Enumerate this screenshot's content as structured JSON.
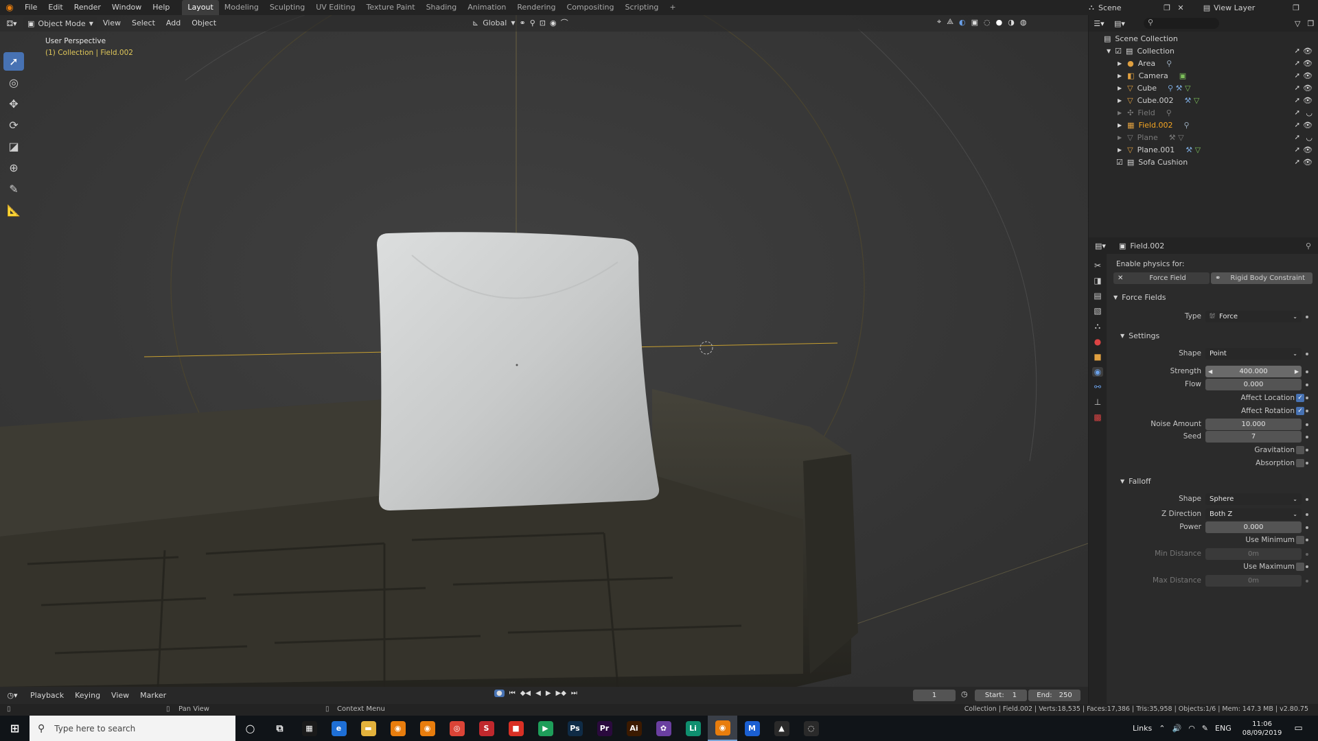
{
  "topbar": {
    "menus": [
      "File",
      "Edit",
      "Render",
      "Window",
      "Help"
    ],
    "workspaces": [
      "Layout",
      "Modeling",
      "Sculpting",
      "UV Editing",
      "Texture Paint",
      "Shading",
      "Animation",
      "Rendering",
      "Compositing",
      "Scripting"
    ],
    "active_workspace": "Layout",
    "add_tab_label": "+",
    "scene_label": "Scene",
    "view_layer_label": "View Layer"
  },
  "viewport_header": {
    "mode": "Object Mode",
    "menus": [
      "View",
      "Select",
      "Add",
      "Object"
    ],
    "transform_orientation": "Global"
  },
  "viewport": {
    "perspective_label": "User Perspective",
    "collection_label": "(1) Collection | Field.002",
    "colors": {
      "cushion": "#cfd1d1",
      "sofa": "#3a382f",
      "background": "#393939",
      "field_lines": "#c8a030"
    }
  },
  "outliner": {
    "root": "Scene Collection",
    "items": [
      {
        "name": "Collection",
        "state": "normal"
      },
      {
        "name": "Area",
        "state": "normal"
      },
      {
        "name": "Camera",
        "state": "normal"
      },
      {
        "name": "Cube",
        "state": "normal"
      },
      {
        "name": "Cube.002",
        "state": "normal"
      },
      {
        "name": "Field",
        "state": "dim"
      },
      {
        "name": "Field.002",
        "state": "selected"
      },
      {
        "name": "Plane",
        "state": "dim"
      },
      {
        "name": "Plane.001",
        "state": "normal"
      },
      {
        "name": "Sofa Cushion",
        "state": "normal"
      }
    ]
  },
  "properties": {
    "object_name": "Field.002",
    "enable_physics_label": "Enable physics for:",
    "force_field_button": "Force Field",
    "rigid_body_button": "Rigid Body Constraint",
    "force_fields_panel": "Force Fields",
    "type_label": "Type",
    "type_value": "Force",
    "settings_panel": "Settings",
    "shape_label": "Shape",
    "shape_value": "Point",
    "strength_label": "Strength",
    "strength_value": "400.000",
    "flow_label": "Flow",
    "flow_value": "0.000",
    "affect_location_label": "Affect Location",
    "affect_location": true,
    "affect_rotation_label": "Affect Rotation",
    "affect_rotation": true,
    "noise_amount_label": "Noise Amount",
    "noise_amount_value": "10.000",
    "seed_label": "Seed",
    "seed_value": "7",
    "gravitation_label": "Gravitation",
    "absorption_label": "Absorption",
    "falloff_panel": "Falloff",
    "falloff_shape_label": "Shape",
    "falloff_shape_value": "Sphere",
    "z_direction_label": "Z Direction",
    "z_direction_value": "Both Z",
    "power_label": "Power",
    "power_value": "0.000",
    "use_minimum_label": "Use Minimum",
    "min_distance_label": "Min Distance",
    "min_distance_value": "0m",
    "use_maximum_label": "Use Maximum",
    "max_distance_label": "Max Distance",
    "max_distance_value": "0m"
  },
  "timeline": {
    "menus": [
      "Playback",
      "Keying",
      "View",
      "Marker"
    ],
    "current_frame": "1",
    "start_label": "Start:",
    "start_value": "1",
    "end_label": "End:",
    "end_value": "250"
  },
  "statusbar": {
    "pan_view": "Pan View",
    "context_menu": "Context Menu",
    "stats": "Collection | Field.002 | Verts:18,535 | Faces:17,386 | Tris:35,958 | Objects:1/6 | Mem: 147.3 MB | v2.80.75"
  },
  "taskbar": {
    "search_placeholder": "Type here to search",
    "links_label": "Links",
    "lang": "ENG",
    "time": "11:06",
    "date": "08/09/2019",
    "apps": [
      {
        "icon": "calculator-icon",
        "glyph": "▦",
        "color": "#1a1a1a"
      },
      {
        "icon": "edge-icon",
        "glyph": "e",
        "color": "#1e6fd6"
      },
      {
        "icon": "file-explorer-icon",
        "glyph": "▬",
        "color": "#e3b23c"
      },
      {
        "icon": "blender-icon",
        "glyph": "◉",
        "color": "#e87d0d"
      },
      {
        "icon": "blender-alt-icon",
        "glyph": "◉",
        "color": "#e87d0d"
      },
      {
        "icon": "chrome-icon",
        "glyph": "◎",
        "color": "#db4437"
      },
      {
        "icon": "app-red-icon",
        "glyph": "S",
        "color": "#c0282d"
      },
      {
        "icon": "app-red2-icon",
        "glyph": "■",
        "color": "#d93025"
      },
      {
        "icon": "play-icon",
        "glyph": "▶",
        "color": "#1e9e5a"
      },
      {
        "icon": "photoshop-icon",
        "glyph": "Ps",
        "color": "#0f2b46"
      },
      {
        "icon": "premiere-icon",
        "glyph": "Pr",
        "color": "#2a0a3d"
      },
      {
        "icon": "illustrator-icon",
        "glyph": "Ai",
        "color": "#3b1a00"
      },
      {
        "icon": "colorful-app-icon",
        "glyph": "✿",
        "color": "#6a3fa0"
      },
      {
        "icon": "live-app-icon",
        "glyph": "Li",
        "color": "#0f8f6f"
      },
      {
        "icon": "blender-active-icon",
        "glyph": "◉",
        "color": "#e87d0d"
      },
      {
        "icon": "malwarebytes-icon",
        "glyph": "M",
        "color": "#1b5fd1"
      },
      {
        "icon": "photos-icon",
        "glyph": "▲",
        "color": "#2a2a2a"
      },
      {
        "icon": "app-circle-icon",
        "glyph": "◌",
        "color": "#2a2a2a"
      }
    ]
  }
}
